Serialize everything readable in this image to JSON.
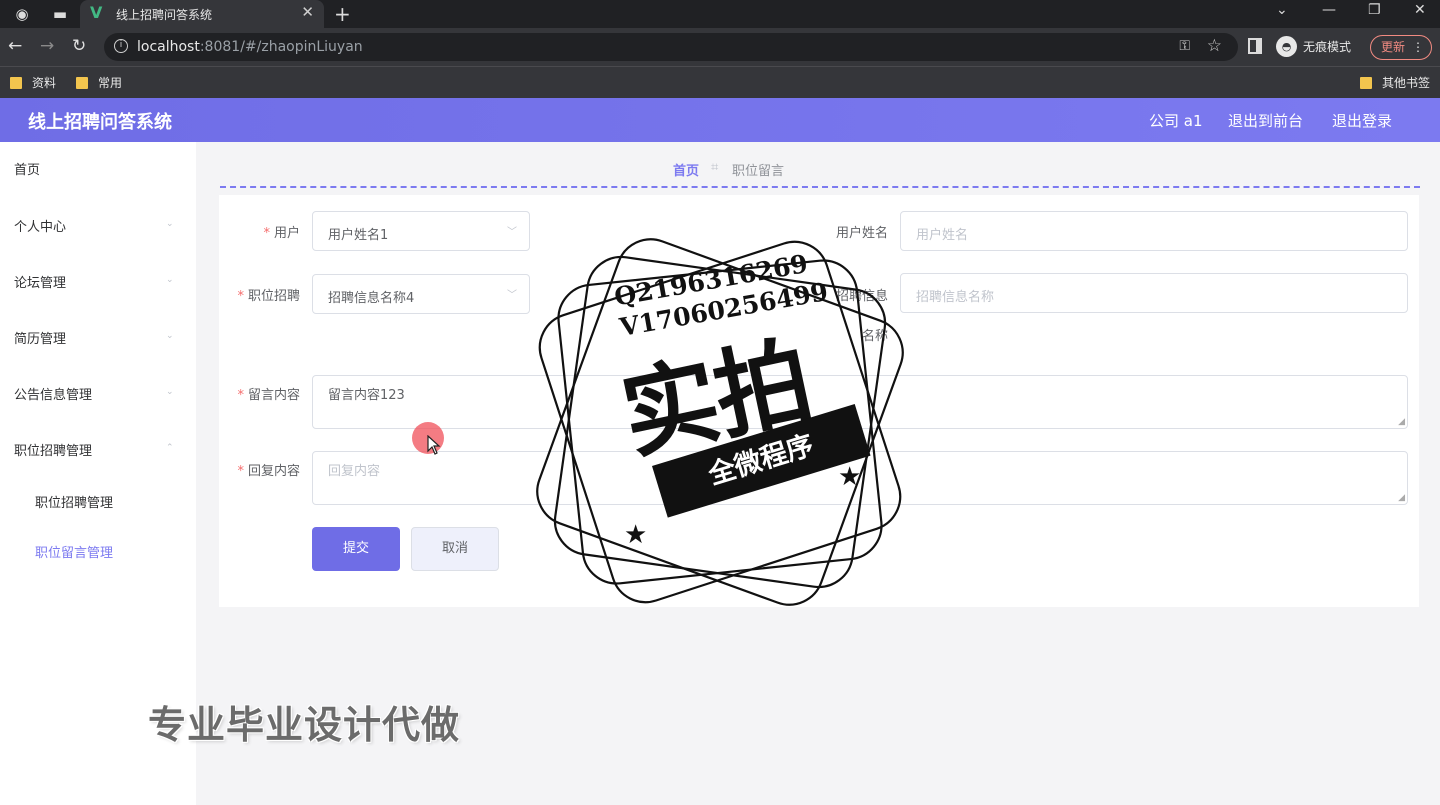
{
  "browser": {
    "tab_title": "线上招聘问答系统",
    "url_host": "localhost",
    "url_rest": ":8081/#/zhaopinLiuyan",
    "incognito_label": "无痕模式",
    "update_label": "更新",
    "bookmarks": [
      "资料",
      "常用"
    ],
    "other_bookmarks": "其他书签"
  },
  "header": {
    "title": "线上招聘问答系统",
    "user_label": "公司 a1",
    "front_label": "退出到前台",
    "logout_label": "退出登录"
  },
  "sidebar": {
    "items": [
      {
        "label": "首页"
      },
      {
        "label": "个人中心"
      },
      {
        "label": "论坛管理"
      },
      {
        "label": "简历管理"
      },
      {
        "label": "公告信息管理"
      },
      {
        "label": "职位招聘管理"
      }
    ],
    "sub_items": [
      {
        "label": "职位招聘管理"
      },
      {
        "label": "职位留言管理"
      }
    ]
  },
  "breadcrumb": {
    "home": "首页",
    "current": "职位留言"
  },
  "form": {
    "user_label": "用户",
    "user_value": "用户姓名1",
    "username_label": "用户姓名",
    "username_placeholder": "用户姓名",
    "job_label": "职位招聘",
    "job_value": "招聘信息名称4",
    "jobname_label_line1": "招聘信息",
    "jobname_label_line2": "名称",
    "jobname_placeholder": "招聘信息名称",
    "message_label": "留言内容",
    "message_value": "留言内容123",
    "reply_label": "回复内容",
    "reply_placeholder": "回复内容",
    "submit_label": "提交",
    "cancel_label": "取消"
  },
  "watermark": {
    "phone1": "Q2196316269",
    "phone2": "V17060256499",
    "big": "实拍",
    "banner": "全微程序",
    "promo": "专业毕业设计代做"
  },
  "colors": {
    "accent": "#7c7af0",
    "required": "#f56c6c"
  }
}
